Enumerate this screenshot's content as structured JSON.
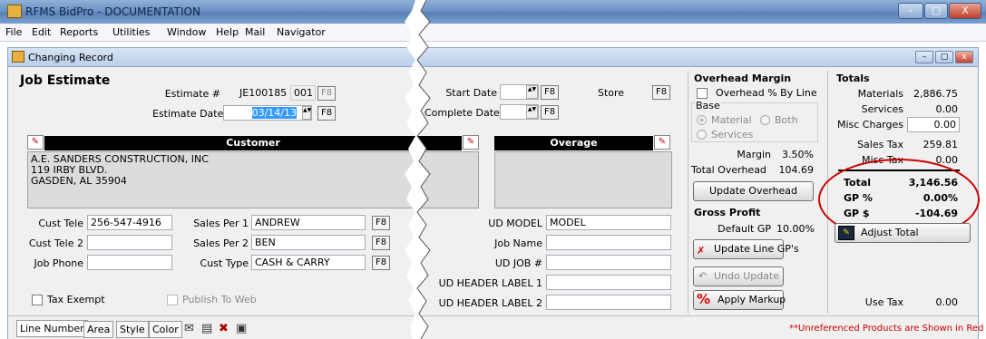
{
  "window": {
    "title": "RFMS BidPro - DOCUMENTATION",
    "minimize": "–",
    "restore": "▢",
    "close": "X"
  },
  "menu": [
    "File",
    "Edit",
    "Reports",
    "Utilities",
    "Window",
    "Help",
    "Mail",
    "Navigator"
  ],
  "child": {
    "title": "Changing Record"
  },
  "job": {
    "heading": "Job Estimate",
    "estimate_label": "Estimate #",
    "estimate_value": "JE100185",
    "estimate_suffix": "001",
    "estimate_date_label": "Estimate Date",
    "estimate_date": "03/14/13",
    "f8": "F8",
    "start_date_label": "Start Date",
    "complete_date_label": "Complete Date",
    "store_label": "Store"
  },
  "customer": {
    "header": "Customer",
    "address": [
      "A.E. SANDERS CONSTRUCTION, INC",
      "119 IRBY BLVD.",
      "GASDEN, AL 35904"
    ]
  },
  "overage": {
    "header": "Overage"
  },
  "fields": {
    "cust_tele_label": "Cust Tele",
    "cust_tele": "256-547-4916",
    "cust_tele2_label": "Cust Tele 2",
    "job_phone_label": "Job Phone",
    "sales1_label": "Sales Per 1",
    "sales1": "ANDREW",
    "sales2_label": "Sales Per 2",
    "sales2": "BEN",
    "cust_type_label": "Cust Type",
    "cust_type": "CASH & CARRY",
    "tax_exempt": "Tax Exempt",
    "publish": "Publish To Web",
    "ud_model_label": "UD MODEL",
    "ud_model": "MODEL",
    "job_name_label": "Job Name",
    "ud_job_label": "UD JOB #",
    "ud_h1_label": "UD HEADER LABEL 1",
    "ud_h2_label": "UD HEADER LABEL 2"
  },
  "overhead": {
    "title": "Overhead Margin",
    "by_line": "Overhead % By Line",
    "base": "Base",
    "material": "Material",
    "both": "Both",
    "services": "Services",
    "margin_label": "Margin",
    "margin": "3.50%",
    "total_label": "Total Overhead",
    "total": "104.69",
    "update_btn": "Update Overhead"
  },
  "gross": {
    "title": "Gross Profit",
    "default_label": "Default GP",
    "default": "10.00%",
    "update_line": "Update Line GP's",
    "undo": "Undo Update",
    "apply": "Apply Markup"
  },
  "totals": {
    "title": "Totals",
    "materials_label": "Materials",
    "materials": "2,886.75",
    "services_label": "Services",
    "services": "0.00",
    "misc_label": "Misc Charges",
    "misc": "0.00",
    "sales_tax_label": "Sales Tax",
    "sales_tax": "259.81",
    "misc_tax_label": "Misc Tax",
    "misc_tax": "0.00",
    "total_label": "Total",
    "total": "3,146.56",
    "gp_pct_label": "GP %",
    "gp_pct": "0.00%",
    "gp_usd_label": "GP $",
    "gp_usd": "-104.69",
    "adjust": "Adjust Total",
    "use_tax_label": "Use Tax",
    "use_tax": "0.00"
  },
  "tabs": [
    "Line Number",
    "Area",
    "Style",
    "Color"
  ],
  "notice": "**Unreferenced Products are Shown in Red",
  "colors": {
    "accent_red": "#cc0000",
    "highlight": "#3399ff",
    "title_blue": "#6d93c6"
  }
}
